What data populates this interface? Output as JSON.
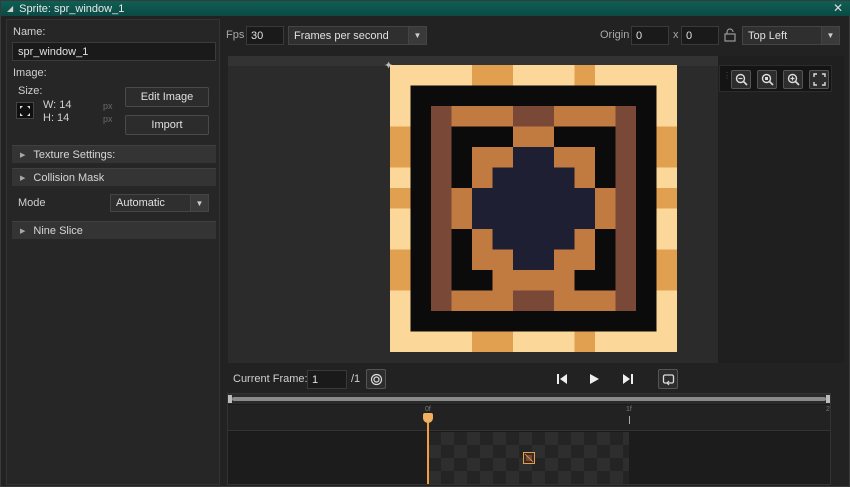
{
  "window": {
    "title": "Sprite: spr_window_1",
    "close": "✕"
  },
  "left": {
    "name_label": "Name:",
    "name_value": "spr_window_1",
    "image_label": "Image:",
    "size_label": "Size:",
    "width": "W: 14",
    "height": "H: 14",
    "unit": "px",
    "edit_image": "Edit Image",
    "import": "Import",
    "sections": {
      "texture": "Texture Settings:",
      "collision": "Collision Mask",
      "nine_slice": "Nine Slice"
    },
    "mode_label": "Mode",
    "mode_value": "Automatic"
  },
  "toolbar": {
    "fps_label": "Fps",
    "fps_value": "30",
    "fps_unit": "Frames per second",
    "origin_label": "Origin",
    "origin_x": "0",
    "origin_sep": "x",
    "origin_y": "0",
    "origin_preset": "Top Left"
  },
  "playback": {
    "current_frame_label": "Current Frame:",
    "current_frame_value": "1",
    "total_frames": "/1"
  },
  "timeline": {
    "ticks": [
      "0f",
      "1f",
      "2"
    ]
  },
  "colors": {
    "light_tan": "#fbd89a",
    "orange": "#e0a050",
    "dark": "#0b0b0b",
    "brown": "#7a4836",
    "copper": "#c17a40",
    "navy": "#1e1f33",
    "accent": "#f0a040"
  }
}
